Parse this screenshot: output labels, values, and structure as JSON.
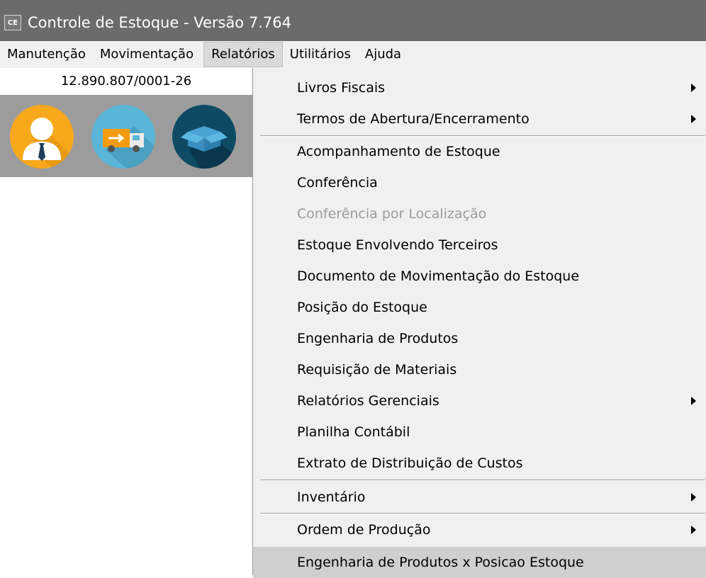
{
  "window": {
    "icon_text": "CE",
    "title": "Controle de Estoque - Versão 7.764"
  },
  "menubar": {
    "items": [
      {
        "label": "Manutenção"
      },
      {
        "label": "Movimentação"
      },
      {
        "label": "Relatórios",
        "active": true
      },
      {
        "label": "Utilitários"
      },
      {
        "label": "Ajuda"
      }
    ]
  },
  "company": {
    "cnpj": "12.890.807/0001-26"
  },
  "toolbar_icons": [
    {
      "name": "user-icon",
      "color": "#f7a81b"
    },
    {
      "name": "delivery-truck-icon",
      "color": "#5ab5d6"
    },
    {
      "name": "box-icon",
      "color": "#0f4a64"
    }
  ],
  "relatorios_menu": {
    "items": [
      {
        "label": "Livros Fiscais",
        "submenu": true
      },
      {
        "label": "Termos de Abertura/Encerramento",
        "submenu": true
      },
      {
        "label": "Acompanhamento de Estoque"
      },
      {
        "label": "Conferência"
      },
      {
        "label": "Conferência por Localização",
        "disabled": true
      },
      {
        "label": "Estoque Envolvendo Terceiros"
      },
      {
        "label": "Documento de Movimentação do Estoque"
      },
      {
        "label": "Posição do Estoque"
      },
      {
        "label": "Engenharia de Produtos"
      },
      {
        "label": "Requisição de Materiais"
      },
      {
        "label": "Relatórios Gerenciais",
        "submenu": true
      },
      {
        "label": "Planilha Contábil"
      },
      {
        "label": "Extrato de Distribuição de Custos"
      },
      {
        "label": "Inventário",
        "submenu": true
      },
      {
        "label": "Ordem de Produção",
        "submenu": true
      },
      {
        "label": "Engenharia de Produtos x Posicao Estoque",
        "highlighted": true
      }
    ]
  }
}
